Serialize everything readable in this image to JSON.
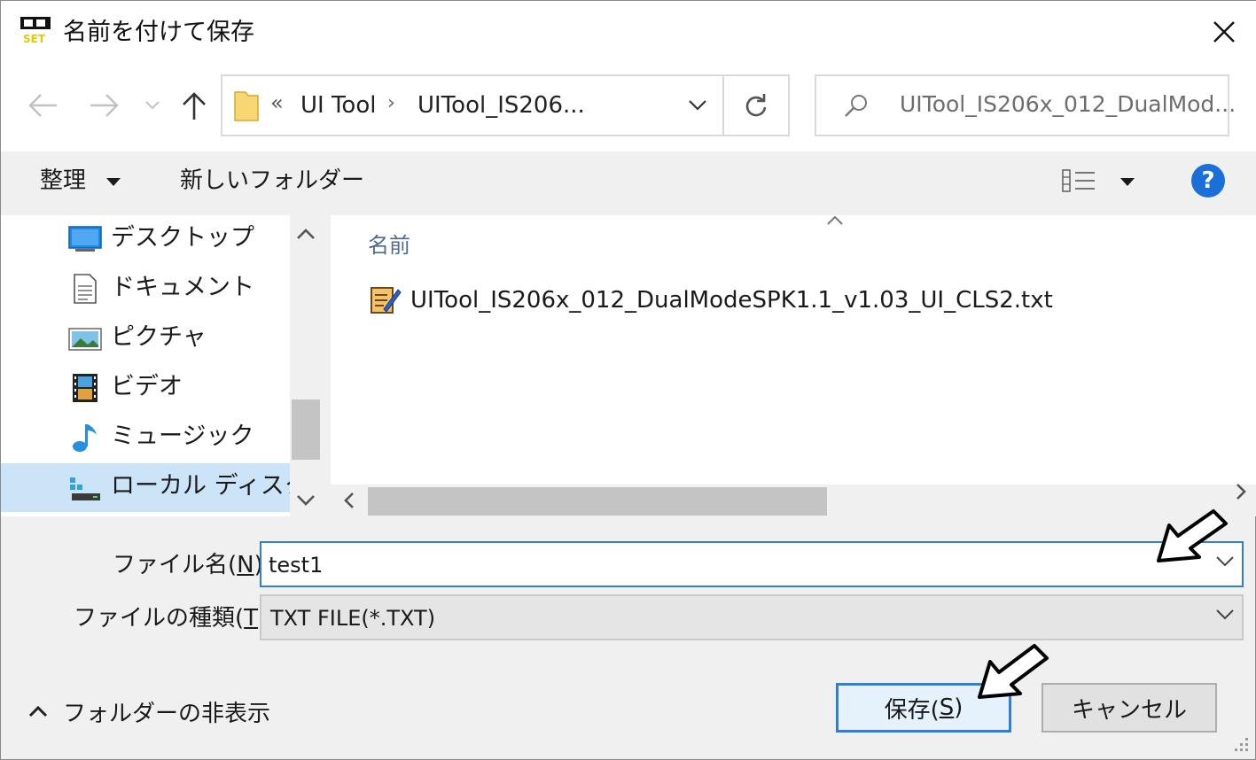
{
  "window": {
    "title": "名前を付けて保存",
    "app_icon_text": "BT SET"
  },
  "address": {
    "breadcrumbs": [
      "UI Tool",
      "UITool_IS206..."
    ],
    "overflow_glyph": "«",
    "separator": "›"
  },
  "search": {
    "placeholder": "UITool_IS206x_012_DualMod..."
  },
  "toolbar": {
    "organize_label": "整理",
    "new_folder_label": "新しいフォルダー",
    "help_label": "?"
  },
  "nav_pane": {
    "items": [
      {
        "label": "デスクトップ",
        "icon": "desktop-icon"
      },
      {
        "label": "ドキュメント",
        "icon": "document-icon"
      },
      {
        "label": "ピクチャ",
        "icon": "picture-icon"
      },
      {
        "label": "ビデオ",
        "icon": "video-icon"
      },
      {
        "label": "ミュージック",
        "icon": "music-icon"
      },
      {
        "label": "ローカル ディスク (C",
        "icon": "local-disk-icon",
        "selected": true
      }
    ]
  },
  "file_list": {
    "column_name": "名前",
    "files": [
      {
        "name": "UITool_IS206x_012_DualModeSPK1.1_v1.03_UI_CLS2.txt",
        "icon": "text-file-icon"
      }
    ]
  },
  "form": {
    "filename_label_pre": "ファイル名(",
    "filename_label_key": "N",
    "filename_label_post": "):",
    "filename_value": "test1",
    "filetype_label_pre": "ファイルの種類(",
    "filetype_label_key": "T",
    "filetype_label_post": "):",
    "filetype_value": "TXT FILE(*.TXT)"
  },
  "footer": {
    "hide_folders_label": "フォルダーの非表示",
    "save_label_pre": "保存(",
    "save_label_key": "S",
    "save_label_post": ")",
    "cancel_label": "キャンセル"
  },
  "colors": {
    "accent": "#2f7fd9",
    "selection": "#cce4f7",
    "help": "#1c6fd8"
  }
}
